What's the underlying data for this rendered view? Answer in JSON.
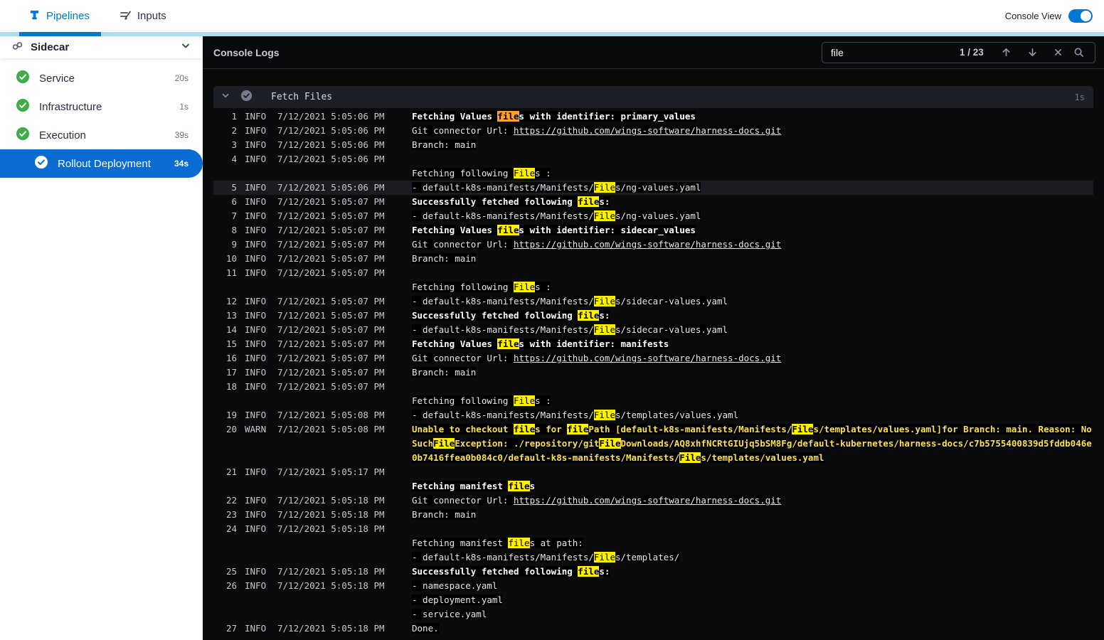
{
  "topbar": {
    "tabs": [
      {
        "label": "Pipelines",
        "active": true
      },
      {
        "label": "Inputs",
        "active": false
      }
    ],
    "console_view_label": "Console View",
    "console_view_on": true
  },
  "colors": {
    "accent_blue": "#0278d5",
    "selected_blue": "#0a6bd2",
    "success_green": "#3fae48",
    "highlight_yellow": "#fcf000",
    "highlight_current_orange": "#fba02f",
    "warn_text": "#fbe23d",
    "console_bg": "#0a0b0d"
  },
  "sidebar": {
    "title": "Sidecar",
    "items": [
      {
        "label": "Service",
        "time": "20s",
        "status": "success"
      },
      {
        "label": "Infrastructure",
        "time": "1s",
        "status": "success"
      },
      {
        "label": "Execution",
        "time": "39s",
        "status": "success"
      },
      {
        "label": "Rollout Deployment",
        "time": "34s",
        "status": "success",
        "selected": true
      }
    ]
  },
  "console": {
    "title": "Console Logs",
    "search": {
      "value": "file",
      "counter": "1 / 23"
    },
    "section": {
      "title": "Fetch Files",
      "time": "1s"
    },
    "entries": [
      {
        "num": 1,
        "level": "INFO",
        "time": "7/12/2021 5:05:06 PM",
        "lines": [
          {
            "bold": true,
            "segs": [
              {
                "t": "Fetching Values "
              },
              {
                "t": "file",
                "m": "c"
              },
              {
                "t": "s with identifier: primary_values"
              }
            ]
          }
        ]
      },
      {
        "num": 2,
        "level": "INFO",
        "time": "7/12/2021 5:05:06 PM",
        "lines": [
          {
            "segs": [
              {
                "t": "Git connector Url: "
              },
              {
                "t": "https://github.com/wings-software/harness-docs.git",
                "m": "l"
              }
            ]
          }
        ]
      },
      {
        "num": 3,
        "level": "INFO",
        "time": "7/12/2021 5:05:06 PM",
        "lines": [
          {
            "segs": [
              {
                "t": "Branch: main"
              }
            ]
          }
        ]
      },
      {
        "num": 4,
        "level": "INFO",
        "time": "7/12/2021 5:05:06 PM",
        "lines": [
          {
            "segs": []
          },
          {
            "segs": [
              {
                "t": "Fetching following "
              },
              {
                "t": "File",
                "m": "h"
              },
              {
                "t": "s :"
              }
            ]
          }
        ]
      },
      {
        "num": 5,
        "level": "INFO",
        "time": "7/12/2021 5:05:06 PM",
        "row_highlight": true,
        "lines": [
          {
            "segs": [
              {
                "t": "- default-k8s-manifests/Manifests/"
              },
              {
                "t": "File",
                "m": "h"
              },
              {
                "t": "s/ng-values.yaml"
              }
            ]
          }
        ]
      },
      {
        "num": 6,
        "level": "INFO",
        "time": "7/12/2021 5:05:07 PM",
        "lines": [
          {
            "bold": true,
            "segs": [
              {
                "t": "Successfully fetched following "
              },
              {
                "t": "file",
                "m": "h"
              },
              {
                "t": "s:"
              }
            ]
          }
        ]
      },
      {
        "num": 7,
        "level": "INFO",
        "time": "7/12/2021 5:05:07 PM",
        "lines": [
          {
            "segs": [
              {
                "t": "- default-k8s-manifests/Manifests/"
              },
              {
                "t": "File",
                "m": "h"
              },
              {
                "t": "s/ng-values.yaml"
              }
            ]
          }
        ]
      },
      {
        "num": 8,
        "level": "INFO",
        "time": "7/12/2021 5:05:07 PM",
        "lines": [
          {
            "bold": true,
            "segs": [
              {
                "t": "Fetching Values "
              },
              {
                "t": "file",
                "m": "h"
              },
              {
                "t": "s with identifier: sidecar_values"
              }
            ]
          }
        ]
      },
      {
        "num": 9,
        "level": "INFO",
        "time": "7/12/2021 5:05:07 PM",
        "lines": [
          {
            "segs": [
              {
                "t": "Git connector Url: "
              },
              {
                "t": "https://github.com/wings-software/harness-docs.git",
                "m": "l"
              }
            ]
          }
        ]
      },
      {
        "num": 10,
        "level": "INFO",
        "time": "7/12/2021 5:05:07 PM",
        "lines": [
          {
            "segs": [
              {
                "t": "Branch: main"
              }
            ]
          }
        ]
      },
      {
        "num": 11,
        "level": "INFO",
        "time": "7/12/2021 5:05:07 PM",
        "lines": [
          {
            "segs": []
          },
          {
            "segs": [
              {
                "t": "Fetching following "
              },
              {
                "t": "File",
                "m": "h"
              },
              {
                "t": "s :"
              }
            ]
          }
        ]
      },
      {
        "num": 12,
        "level": "INFO",
        "time": "7/12/2021 5:05:07 PM",
        "lines": [
          {
            "segs": [
              {
                "t": "- default-k8s-manifests/Manifests/"
              },
              {
                "t": "File",
                "m": "h"
              },
              {
                "t": "s/sidecar-values.yaml"
              }
            ]
          }
        ]
      },
      {
        "num": 13,
        "level": "INFO",
        "time": "7/12/2021 5:05:07 PM",
        "lines": [
          {
            "bold": true,
            "segs": [
              {
                "t": "Successfully fetched following "
              },
              {
                "t": "file",
                "m": "h"
              },
              {
                "t": "s:"
              }
            ]
          }
        ]
      },
      {
        "num": 14,
        "level": "INFO",
        "time": "7/12/2021 5:05:07 PM",
        "lines": [
          {
            "segs": [
              {
                "t": "- default-k8s-manifests/Manifests/"
              },
              {
                "t": "File",
                "m": "h"
              },
              {
                "t": "s/sidecar-values.yaml"
              }
            ]
          }
        ]
      },
      {
        "num": 15,
        "level": "INFO",
        "time": "7/12/2021 5:05:07 PM",
        "lines": [
          {
            "bold": true,
            "segs": [
              {
                "t": "Fetching Values "
              },
              {
                "t": "file",
                "m": "h"
              },
              {
                "t": "s with identifier: manifests"
              }
            ]
          }
        ]
      },
      {
        "num": 16,
        "level": "INFO",
        "time": "7/12/2021 5:05:07 PM",
        "lines": [
          {
            "segs": [
              {
                "t": "Git connector Url: "
              },
              {
                "t": "https://github.com/wings-software/harness-docs.git",
                "m": "l"
              }
            ]
          }
        ]
      },
      {
        "num": 17,
        "level": "INFO",
        "time": "7/12/2021 5:05:07 PM",
        "lines": [
          {
            "segs": [
              {
                "t": "Branch: main"
              }
            ]
          }
        ]
      },
      {
        "num": 18,
        "level": "INFO",
        "time": "7/12/2021 5:05:07 PM",
        "lines": [
          {
            "segs": []
          },
          {
            "segs": [
              {
                "t": "Fetching following "
              },
              {
                "t": "File",
                "m": "h"
              },
              {
                "t": "s :"
              }
            ]
          }
        ]
      },
      {
        "num": 19,
        "level": "INFO",
        "time": "7/12/2021 5:05:08 PM",
        "lines": [
          {
            "segs": [
              {
                "t": "- default-k8s-manifests/Manifests/"
              },
              {
                "t": "File",
                "m": "h"
              },
              {
                "t": "s/templates/values.yaml"
              }
            ]
          }
        ]
      },
      {
        "num": 20,
        "level": "WARN",
        "time": "7/12/2021 5:05:08 PM",
        "lines": [
          {
            "segs": [
              {
                "t": "Unable to checkout "
              },
              {
                "t": "file",
                "m": "h"
              },
              {
                "t": "s for "
              },
              {
                "t": "file",
                "m": "h"
              },
              {
                "t": "Path [default-k8s-manifests/Manifests/"
              },
              {
                "t": "File",
                "m": "h"
              },
              {
                "t": "s/templates/values.yaml]for Branch: main. Reason: NoSuch"
              },
              {
                "t": "File",
                "m": "h"
              },
              {
                "t": "Exception: ./repository/git"
              },
              {
                "t": "File",
                "m": "h"
              },
              {
                "t": "Downloads/AQ8xhfNCRtGIUjq5bSM8Fg/default-kubernetes/harness-docs/c7b5755400839d5fddb046e0b7416ffea0b084c0/default-k8s-manifests/Manifests/"
              },
              {
                "t": "File",
                "m": "h"
              },
              {
                "t": "s/templates/values.yaml"
              }
            ]
          }
        ]
      },
      {
        "num": 21,
        "level": "INFO",
        "time": "7/12/2021 5:05:17 PM",
        "lines": [
          {
            "segs": []
          },
          {
            "bold": true,
            "segs": [
              {
                "t": "Fetching manifest "
              },
              {
                "t": "file",
                "m": "h"
              },
              {
                "t": "s"
              }
            ]
          }
        ]
      },
      {
        "num": 22,
        "level": "INFO",
        "time": "7/12/2021 5:05:18 PM",
        "lines": [
          {
            "segs": [
              {
                "t": "Git connector Url: "
              },
              {
                "t": "https://github.com/wings-software/harness-docs.git",
                "m": "l"
              }
            ]
          }
        ]
      },
      {
        "num": 23,
        "level": "INFO",
        "time": "7/12/2021 5:05:18 PM",
        "lines": [
          {
            "segs": [
              {
                "t": "Branch: main"
              }
            ]
          }
        ]
      },
      {
        "num": 24,
        "level": "INFO",
        "time": "7/12/2021 5:05:18 PM",
        "lines": [
          {
            "segs": []
          },
          {
            "segs": [
              {
                "t": "Fetching manifest "
              },
              {
                "t": "file",
                "m": "h"
              },
              {
                "t": "s at path:"
              }
            ]
          },
          {
            "segs": [
              {
                "t": "- default-k8s-manifests/Manifests/"
              },
              {
                "t": "File",
                "m": "h"
              },
              {
                "t": "s/templates/"
              }
            ]
          }
        ]
      },
      {
        "num": 25,
        "level": "INFO",
        "time": "7/12/2021 5:05:18 PM",
        "lines": [
          {
            "bold": true,
            "segs": [
              {
                "t": "Successfully fetched following "
              },
              {
                "t": "file",
                "m": "h"
              },
              {
                "t": "s:"
              }
            ]
          }
        ]
      },
      {
        "num": 26,
        "level": "INFO",
        "time": "7/12/2021 5:05:18 PM",
        "lines": [
          {
            "segs": [
              {
                "t": "- namespace.yaml"
              }
            ]
          },
          {
            "segs": [
              {
                "t": "- deployment.yaml"
              }
            ]
          },
          {
            "segs": [
              {
                "t": "- service.yaml"
              }
            ]
          }
        ]
      },
      {
        "num": 27,
        "level": "INFO",
        "time": "7/12/2021 5:05:18 PM",
        "lines": [
          {
            "segs": [
              {
                "t": "Done."
              }
            ]
          }
        ]
      }
    ]
  }
}
